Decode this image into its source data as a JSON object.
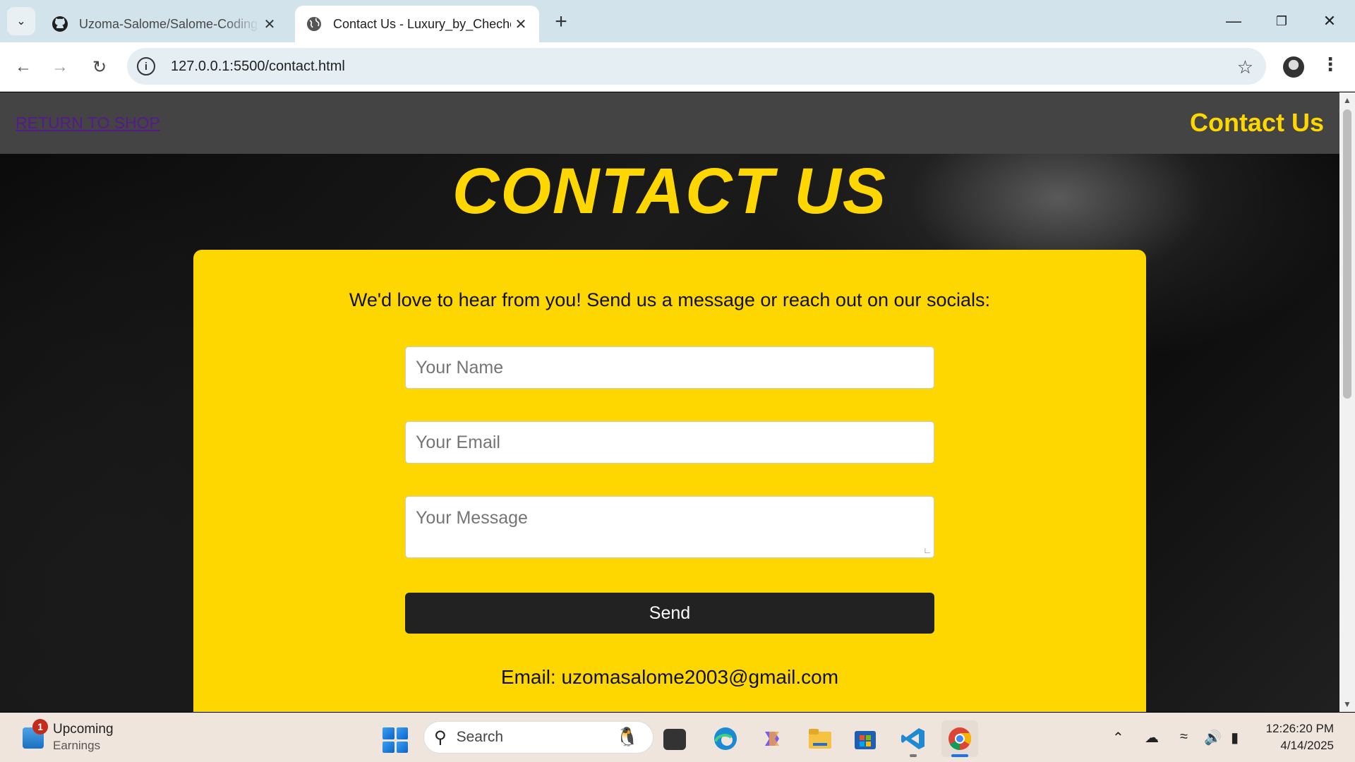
{
  "browser": {
    "tabs": [
      {
        "title": "Uzoma-Salome/Salome-Coding",
        "icon": "github-icon",
        "active": false
      },
      {
        "title": "Contact Us - Luxury_by_Cheche",
        "icon": "globe-icon",
        "active": true
      }
    ],
    "url": "127.0.0.1:5500/contact.html"
  },
  "site": {
    "return_link": "RETURN TO SHOP",
    "header_title": "Contact Us",
    "heading": "CONTACT US",
    "intro": "We'd love to hear from you! Send us a message or reach out on our socials:",
    "form": {
      "name_placeholder": "Your Name",
      "email_placeholder": "Your Email",
      "message_placeholder": "Your Message",
      "send_label": "Send"
    },
    "email_line": "Email: uzomasalome2003@gmail.com",
    "colors": {
      "accent": "#ffd700",
      "header_bg": "#444444",
      "button_bg": "#222222"
    }
  },
  "taskbar": {
    "widget_badge": "1",
    "widget_line1": "Upcoming",
    "widget_line2": "Earnings",
    "search_label": "Search",
    "time": "12:26:20 PM",
    "date": "4/14/2025"
  }
}
